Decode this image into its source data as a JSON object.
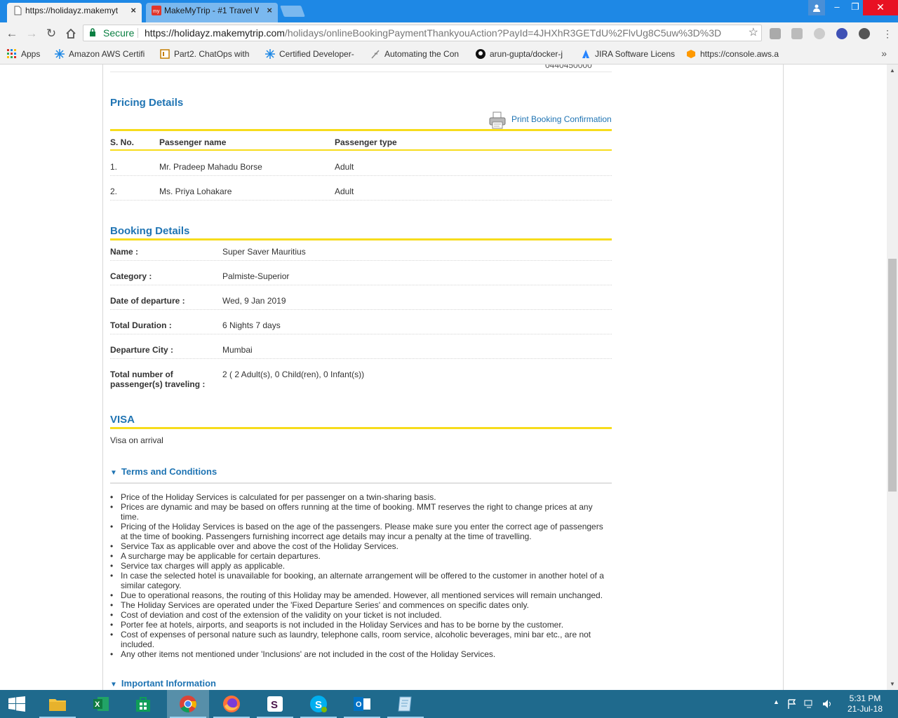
{
  "browser": {
    "tabs": [
      {
        "title": "https://holidayz.makemyt",
        "close": "×"
      },
      {
        "title": "MakeMyTrip - #1 Travel W",
        "close": "×"
      }
    ],
    "window_controls": {
      "user": "user-icon",
      "minimize": "–",
      "maximize": "❐",
      "close": "✕"
    },
    "secure_label": "Secure",
    "url_scheme_host": "https://holidayz.makemytrip.com",
    "url_path": "/holidays/onlineBookingPaymentThankyouAction?PayId=4JHXhR3GETdU%2FlvUg8C5uw%3D%3D",
    "bookmarks": [
      {
        "label": "Apps",
        "icon": "apps-grid-icon"
      },
      {
        "label": "Amazon AWS Certifi",
        "icon": "snowflake-icon"
      },
      {
        "label": "Part2. ChatOps with",
        "icon": "bookmark-doc-icon"
      },
      {
        "label": "Certified Developer-",
        "icon": "snowflake-icon"
      },
      {
        "label": "Automating the Con",
        "icon": "quill-icon"
      },
      {
        "label": "arun-gupta/docker-j",
        "icon": "github-icon"
      },
      {
        "label": "JIRA Software Licens",
        "icon": "jira-icon"
      },
      {
        "label": "https://console.aws.a",
        "icon": "aws-cube-icon"
      }
    ],
    "bookmarks_more": "»"
  },
  "page": {
    "cut_off_text": "0440450000",
    "pricing": {
      "title": "Pricing Details",
      "print_link": "Print Booking Confirmation",
      "headers": [
        "S. No.",
        "Passenger name",
        "Passenger type"
      ],
      "rows": [
        [
          "1.",
          "Mr. Pradeep Mahadu Borse",
          "Adult"
        ],
        [
          "2.",
          "Ms. Priya Lohakare",
          "Adult"
        ]
      ]
    },
    "booking": {
      "title": "Booking Details",
      "fields": [
        {
          "label": "Name :",
          "value": "Super Saver Mauritius"
        },
        {
          "label": "Category :",
          "value": "Palmiste-Superior"
        },
        {
          "label": "Date of departure :",
          "value": "Wed, 9 Jan 2019"
        },
        {
          "label": "Total Duration :",
          "value": "6 Nights 7 days"
        },
        {
          "label": "Departure City :",
          "value": "Mumbai"
        },
        {
          "label": "Total number of passenger(s) traveling :",
          "value": "2 ( 2 Adult(s), 0 Child(ren), 0 Infant(s))"
        }
      ]
    },
    "visa": {
      "title": "VISA",
      "text": "Visa on arrival"
    },
    "terms": {
      "title": "Terms and Conditions",
      "items": [
        "",
        "Price of the Holiday Services is calculated for per passenger on a twin-sharing basis.",
        "Prices are dynamic and may be based on offers running at the time of booking. MMT reserves the right to change prices at any time.",
        "Pricing of the Holiday Services is based on the age of the passengers. Please make sure you enter the correct age of passengers at the time of booking. Passengers furnishing incorrect age details may incur a penalty at the time of travelling.",
        "Service Tax as applicable over and above the cost of the Holiday Services.",
        "A surcharge may be applicable for certain departures.",
        "Service tax charges will apply as applicable.",
        "In case the selected hotel is unavailable for booking, an alternate arrangement will be offered to the customer in another hotel of a similar category.",
        "Due to operational reasons, the routing of this Holiday may be amended. However, all mentioned services will remain unchanged.",
        "The Holiday Services are operated under the 'Fixed Departure Series' and commences on specific dates only.",
        "Cost of deviation and cost of the extension of the validity on your ticket is not included.",
        "Porter fee at hotels, airports, and seaports is not included in the Holiday Services and has to be borne by the customer.",
        "Cost of expenses of personal nature such as laundry, telephone calls, room service, alcoholic beverages, mini bar etc., are not included.",
        "Any other items not mentioned under 'Inclusions' are not included in the cost of the Holiday Services."
      ]
    },
    "important_info": {
      "title": "Important Information"
    }
  },
  "taskbar": {
    "apps": [
      "windows-start-icon",
      "file-explorer-icon",
      "excel-icon",
      "store-icon",
      "chrome-icon",
      "firefox-icon",
      "slack-icon",
      "skype-icon",
      "outlook-icon",
      "notepad-icon"
    ],
    "time": "5:31 PM",
    "date": "21-Jul-18"
  },
  "colors": {
    "accent_blue": "#1f74b3",
    "yellow_rule": "#f7dc1c",
    "secure_green": "#0b8043",
    "chrome_tabbar": "#1e88e5",
    "taskbar": "#1f6a8d"
  }
}
